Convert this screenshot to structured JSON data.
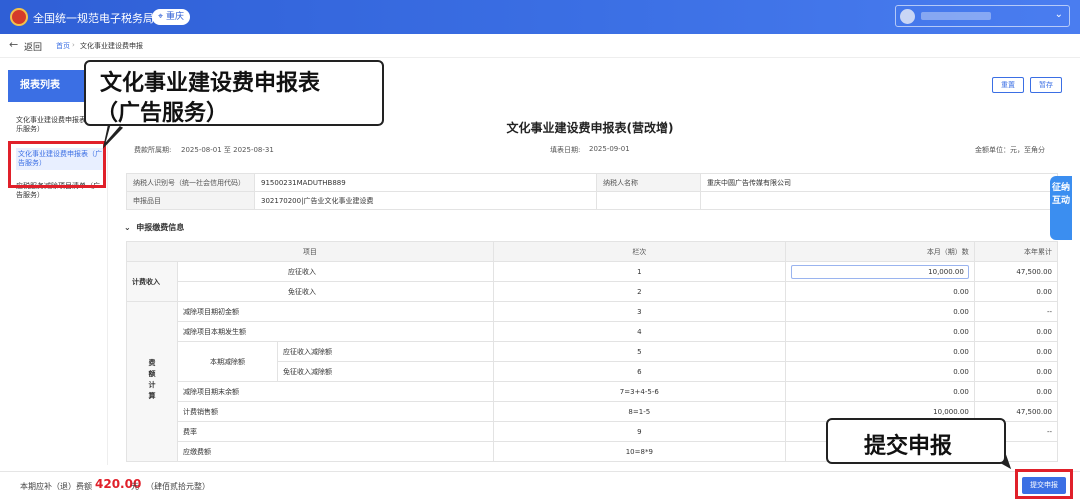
{
  "header": {
    "site_title": "全国统一规范电子税务局",
    "region": "重庆"
  },
  "breadcrumb": {
    "back_label": "返回",
    "home": "首页",
    "separator": "›",
    "current": "文化事业建设费申报"
  },
  "sidebar": {
    "title": "报表列表",
    "items": [
      {
        "label": "文化事业建设费申报表（娱乐服务）"
      },
      {
        "label": "文化事业建设费申报表（广告服务）",
        "active": true
      },
      {
        "label": "应税服务减除项目清单（广告服务）"
      }
    ]
  },
  "annotations": {
    "callout_line1": "文化事业建设费申报表",
    "callout_line2": "（广告服务）",
    "submit_callout": "提交申报"
  },
  "toolbar": {
    "reset_label": "重置",
    "save_label": "暂存"
  },
  "form": {
    "title": "文化事业建设费申报表(营改增)",
    "period_label": "费款所属期:",
    "period_value": "2025-08-01 至 2025-08-31",
    "fill_date_label": "填表日期:",
    "fill_date_value": "2025-09-01",
    "unit_note": "金额单位：元，至角分"
  },
  "taxpayer": {
    "id_label": "纳税人识别号（统一社会信用代码）",
    "id_value": "91500231MADUTHB889",
    "name_label": "纳税人名称",
    "name_value": "重庆中圆广告传媒有限公司",
    "item_label": "申报品目",
    "item_value": "302170200|广告业文化事业建设费"
  },
  "section_title": "申报缴费信息",
  "table": {
    "headers": [
      "项目",
      "栏次",
      "本月（期）数",
      "本年累计"
    ],
    "group_income": "计费收入",
    "group_fee": "费额计算",
    "sub_reduce": "本期减除额",
    "rows": [
      {
        "label": "应征收入",
        "line": "1",
        "month": "10,000.00",
        "year": "47,500.00"
      },
      {
        "label": "免征收入",
        "line": "2",
        "month": "0.00",
        "year": "0.00"
      },
      {
        "label": "减除项目期初金额",
        "line": "3",
        "month": "0.00",
        "year": "--"
      },
      {
        "label": "减除项目本期发生额",
        "line": "4",
        "month": "0.00",
        "year": "0.00"
      },
      {
        "label": "应征收入减除额",
        "line": "5",
        "month": "0.00",
        "year": "0.00"
      },
      {
        "label": "免征收入减除额",
        "line": "6",
        "month": "0.00",
        "year": "0.00"
      },
      {
        "label": "减除项目期末余额",
        "line": "7=3+4-5-6",
        "month": "0.00",
        "year": "0.00"
      },
      {
        "label": "计费销售额",
        "line": "8=1-5",
        "month": "10,000.00",
        "year": "47,500.00"
      },
      {
        "label": "费率",
        "line": "9",
        "month": "",
        "year": "--"
      },
      {
        "label": "应缴费额",
        "line": "10=8*9",
        "month": "",
        "year": ""
      }
    ]
  },
  "side_tab": "征纳互动",
  "footer": {
    "fee_label": "本期应补（退）费额",
    "fee_amount": "420.00",
    "fee_unit": "元",
    "fee_note": "（肆佰贰拾元整）",
    "submit_label": "提交申报"
  },
  "colors": {
    "primary": "#3b6fe4",
    "highlight_red": "#e0202a"
  }
}
